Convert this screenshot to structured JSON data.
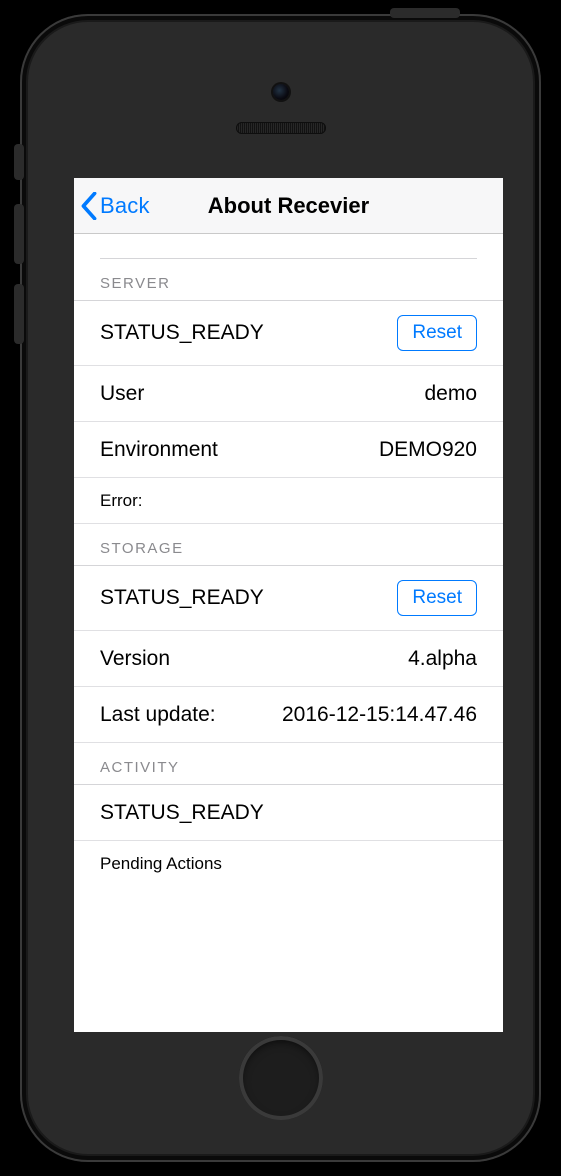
{
  "nav": {
    "back_label": "Back",
    "title": "About Recevier"
  },
  "sections": {
    "server": {
      "header": "SERVER",
      "status": "STATUS_READY",
      "reset_label": "Reset",
      "user_label": "User",
      "user_value": "demo",
      "env_label": "Environment",
      "env_value": "DEMO920",
      "error_label": "Error:"
    },
    "storage": {
      "header": "STORAGE",
      "status": "STATUS_READY",
      "reset_label": "Reset",
      "version_label": "Version",
      "version_value": "4.alpha",
      "last_update_label": "Last update:",
      "last_update_value": "2016-12-15:14.47.46"
    },
    "activity": {
      "header": "ACTIVITY",
      "status": "STATUS_READY",
      "pending_label": "Pending Actions"
    }
  }
}
